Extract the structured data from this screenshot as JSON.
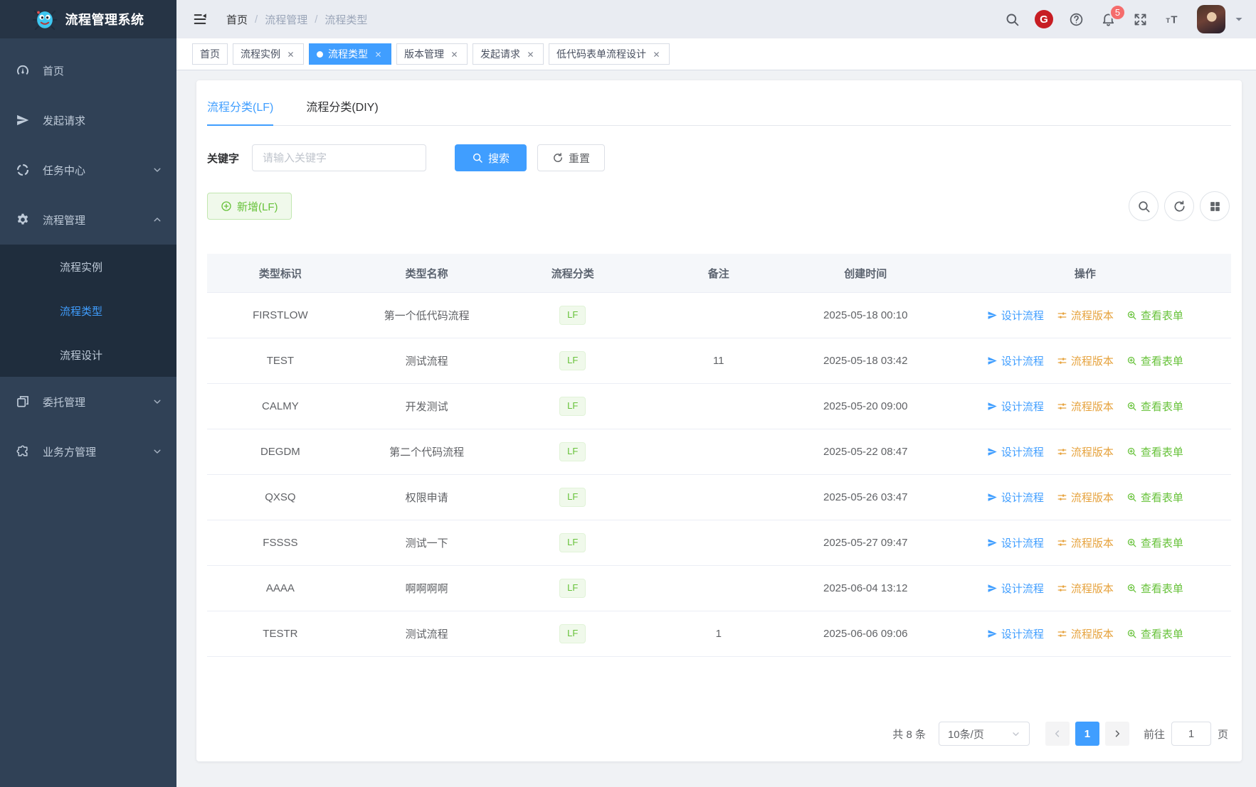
{
  "app": {
    "title": "流程管理系统"
  },
  "sidebar": {
    "items": [
      {
        "label": "首页"
      },
      {
        "label": "发起请求"
      },
      {
        "label": "任务中心"
      },
      {
        "label": "流程管理",
        "children": [
          "流程实例",
          "流程类型",
          "流程设计"
        ]
      },
      {
        "label": "委托管理"
      },
      {
        "label": "业务方管理"
      }
    ]
  },
  "header": {
    "breadcrumb": [
      "首页",
      "流程管理",
      "流程类型"
    ],
    "breadcrumb_separator": "/",
    "bell_badge": "5"
  },
  "tabs": [
    {
      "label": "首页",
      "closable": false,
      "active": false
    },
    {
      "label": "流程实例",
      "closable": true,
      "active": false
    },
    {
      "label": "流程类型",
      "closable": true,
      "active": true
    },
    {
      "label": "版本管理",
      "closable": true,
      "active": false
    },
    {
      "label": "发起请求",
      "closable": true,
      "active": false
    },
    {
      "label": "低代码表单流程设计",
      "closable": true,
      "active": false
    }
  ],
  "panel": {
    "tabs": [
      {
        "label": "流程分类(LF)",
        "active": true
      },
      {
        "label": "流程分类(DIY)",
        "active": false
      }
    ],
    "search": {
      "label": "关键字",
      "placeholder": "请输入关键字",
      "value": "",
      "search_button": "搜索",
      "reset_button": "重置"
    },
    "add_button": "新增(LF)"
  },
  "table": {
    "columns": [
      "类型标识",
      "类型名称",
      "流程分类",
      "备注",
      "创建时间",
      "操作"
    ],
    "actions": [
      "设计流程",
      "流程版本",
      "查看表单"
    ],
    "rows": [
      {
        "code": "FIRSTLOW",
        "name": "第一个低代码流程",
        "category": "LF",
        "remark": "",
        "created": "2025-05-18 00:10"
      },
      {
        "code": "TEST",
        "name": "测试流程",
        "category": "LF",
        "remark": "11",
        "created": "2025-05-18 03:42"
      },
      {
        "code": "CALMY",
        "name": "开发测试",
        "category": "LF",
        "remark": "",
        "created": "2025-05-20 09:00"
      },
      {
        "code": "DEGDM",
        "name": "第二个代码流程",
        "category": "LF",
        "remark": "",
        "created": "2025-05-22 08:47"
      },
      {
        "code": "QXSQ",
        "name": "权限申请",
        "category": "LF",
        "remark": "",
        "created": "2025-05-26 03:47"
      },
      {
        "code": "FSSSS",
        "name": "测试一下",
        "category": "LF",
        "remark": "",
        "created": "2025-05-27 09:47"
      },
      {
        "code": "AAAA",
        "name": "啊啊啊啊",
        "category": "LF",
        "remark": "",
        "created": "2025-06-04 13:12"
      },
      {
        "code": "TESTR",
        "name": "测试流程",
        "category": "LF",
        "remark": "1",
        "created": "2025-06-06 09:06"
      }
    ]
  },
  "pagination": {
    "total_text": "共 8 条",
    "page_size": "10条/页",
    "current_page": "1",
    "goto_label": "前往",
    "goto_value": "1",
    "page_suffix": "页"
  },
  "colors": {
    "primary": "#409eff",
    "success": "#67c23a",
    "warning": "#e6a23c",
    "danger": "#f56c6c",
    "sidebar_bg": "#304156",
    "sidebar_sub_bg": "#1f2d3d",
    "navbar_bg": "#e9ecf2",
    "gitee_red": "#c71d23"
  }
}
